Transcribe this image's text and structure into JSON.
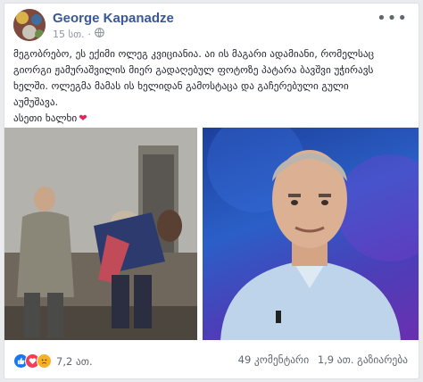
{
  "post": {
    "author": "George Kapanadze",
    "time": "15 სთ.",
    "privacy_icon": "globe-icon",
    "more_icon": "more-options-icon",
    "text_lines": [
      "მეგობრებო, ეს ექიმი ოლეგ კვიციანია. აი ის მაგარი ადამიანი, რომელსაც",
      "გიორგი ჟამურაშვილის მიერ გადაღებულ ფოტოზე პატარა ბავშვი უჭირავს",
      "ხელში. ოლეგმა მამას ის ხელიდან გამოსტაცა და გაჩერებული გული",
      "აუმუშავა.",
      "ასეთი ხალხი"
    ],
    "heart_emoji": "❤️"
  },
  "photos": {
    "left_icon": "rescue-photo",
    "right_icon": "portrait-photo"
  },
  "footer": {
    "reaction_icons": [
      "like-icon",
      "love-icon",
      "sad-icon"
    ],
    "reaction_count": "7,2 ათ.",
    "comments": "49 კომენტარი",
    "shares": "1,9 ათ. გაზიარება"
  },
  "colors": {
    "author": "#385898",
    "like": "#1877f2",
    "love": "#f33e58",
    "sad": "#f7b125"
  }
}
